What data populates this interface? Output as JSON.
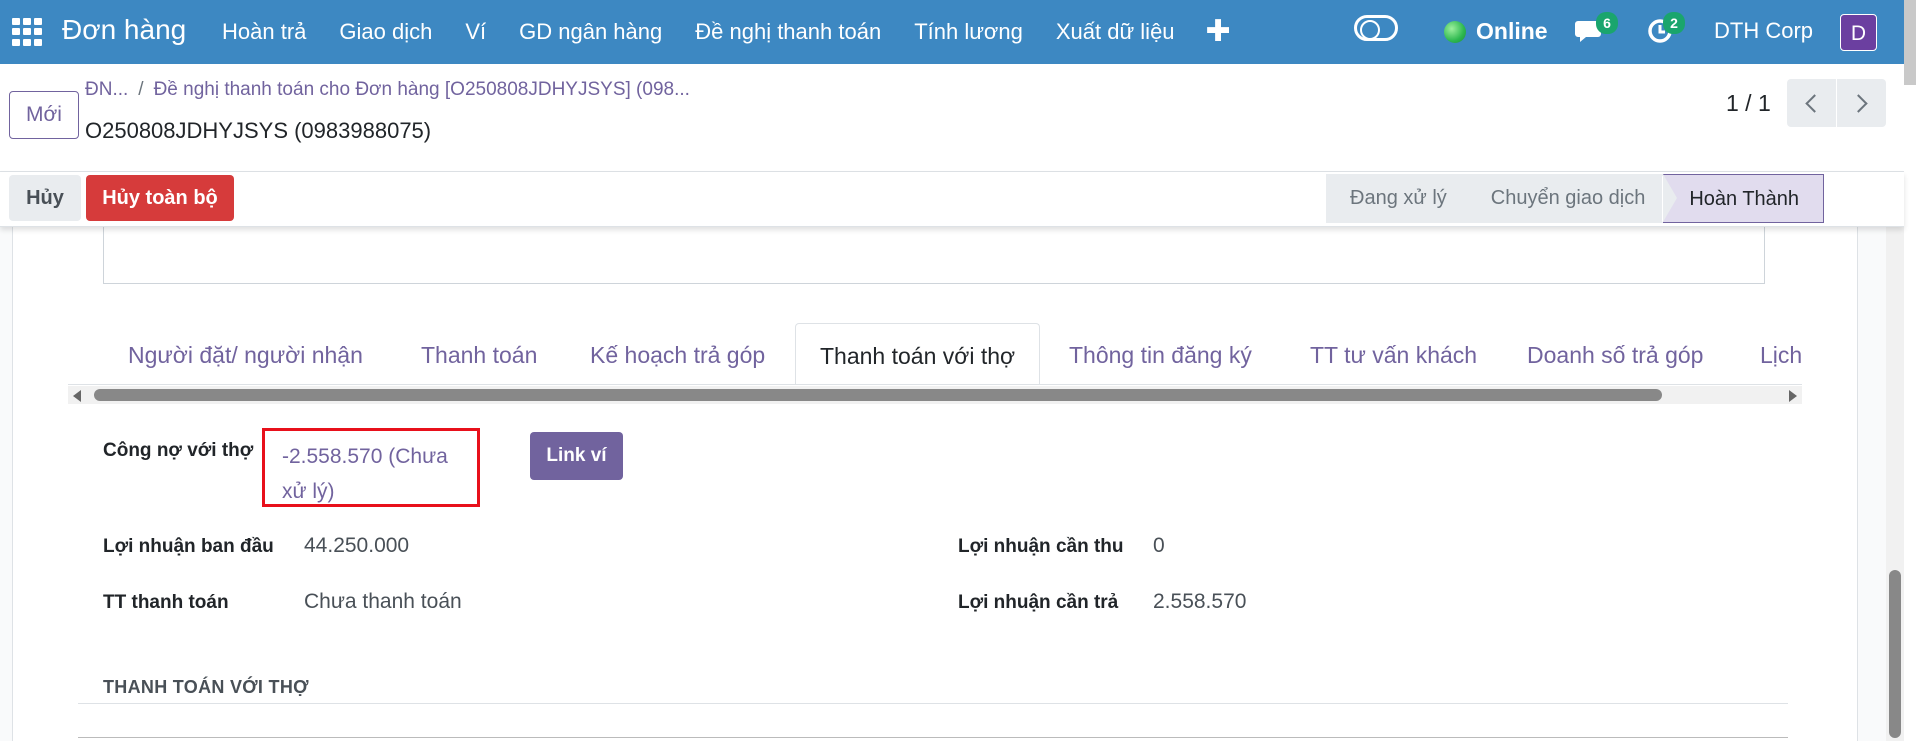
{
  "navbar": {
    "app_title": "Đơn hàng",
    "menu": [
      "Hoàn trả",
      "Giao dịch",
      "Ví",
      "GD ngân hàng",
      "Đề nghị thanh toán",
      "Tính lương",
      "Xuất dữ liệu"
    ],
    "plus": "✚",
    "status": "Online",
    "messages_count": "6",
    "activities_count": "2",
    "company": "DTH Corp",
    "avatar_letter": "D"
  },
  "control_panel": {
    "new_button": "Mới",
    "breadcrumb_1": "ĐN...",
    "breadcrumb_sep": "/",
    "breadcrumb_2": "Đề nghị thanh toán cho Đơn hàng [O250808JDHYJSYS] (098...",
    "record_title": "O250808JDHYJSYS (0983988075)",
    "pager": "1 / 1"
  },
  "statusbar": {
    "cancel_button": "Hủy",
    "cancel_all_button": "Hủy toàn bộ",
    "stages": [
      "Đang xử lý",
      "Chuyển giao dịch",
      "Hoàn Thành"
    ],
    "active_stage": "Hoàn Thành"
  },
  "tabs": [
    "Người đặt/ người nhận",
    "Thanh toán",
    "Kế hoạch trả góp",
    "Thanh toán với thợ",
    "Thông tin đăng ký",
    "TT tư vấn khách",
    "Doanh số trả góp",
    "Lịch"
  ],
  "active_tab": "Thanh toán với thợ",
  "fields": {
    "debt_label": "Công nợ với thợ",
    "debt_value": "-2.558.570 (Chưa xử lý)",
    "link_wallet_button": "Link ví",
    "initial_profit_label": "Lợi nhuận ban đầu",
    "initial_profit_value": "44.250.000",
    "payment_status_label": "TT thanh toán",
    "payment_status_value": "Chưa thanh toán",
    "profit_to_collect_label": "Lợi nhuận cần thu",
    "profit_to_collect_value": "0",
    "profit_to_pay_label": "Lợi nhuận cần trả",
    "profit_to_pay_value": "2.558.570"
  },
  "section": {
    "title": "THANH TOÁN VỚI THỢ"
  },
  "colors": {
    "navbar_bg": "#3d88c2",
    "primary": "#71639e",
    "danger": "#d63b3b",
    "highlight_box": "#e8101b",
    "badge": "#1aa56d"
  }
}
